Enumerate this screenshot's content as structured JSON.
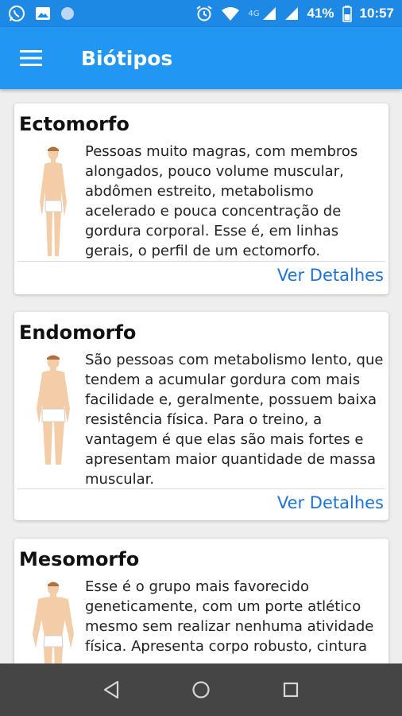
{
  "status_bar": {
    "left_icons": [
      "whatsapp-icon",
      "image-icon",
      "circle-icon"
    ],
    "network_label": "4G",
    "battery_percent": "41%",
    "time": "10:57"
  },
  "app_bar": {
    "title": "Biótipos",
    "menu_icon": "hamburger-menu-icon"
  },
  "cards": [
    {
      "title": "Ectomorfo",
      "description": "Pessoas muito magras, com membros alongados, pouco volume muscular, abdômen estreito, metabolismo acelerado e pouca concentração de gordura corporal. Esse é, em linhas gerais, o perfil de um ectomorfo.",
      "link": "Ver Detalhes"
    },
    {
      "title": "Endomorfo",
      "description": "São pessoas com metabolismo lento, que tendem a acumular gordura com mais facilidade e, geralmente, possuem baixa resistência física. Para o treino, a vantagem é que elas são mais fortes e apresentam maior quantidade de massa muscular.",
      "link": "Ver Detalhes"
    },
    {
      "title": "Mesomorfo",
      "description": "Esse é o grupo mais favorecido geneticamente, com um porte atlético mesmo sem realizar nenhuma atividade física. Apresenta corpo robusto, cintura",
      "link": ""
    }
  ],
  "nav_bar": {
    "icons": [
      "back-icon",
      "home-icon",
      "recents-icon"
    ]
  },
  "colors": {
    "status_bar": "#1e88e5",
    "app_bar": "#2196f3",
    "link": "#1e73d8",
    "nav_bar": "#454545",
    "background": "#eeeeee"
  }
}
